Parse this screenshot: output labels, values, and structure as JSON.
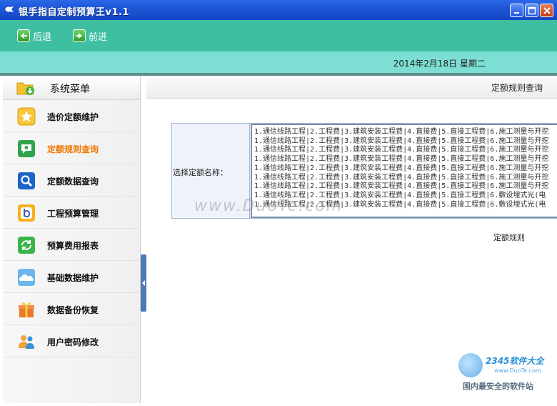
{
  "window": {
    "title": "银手指自定制预算王v1.1"
  },
  "toolbar": {
    "back_label": "后退",
    "forward_label": "前进"
  },
  "status": {
    "date": "2014年2月18日  星期二"
  },
  "sidebar": {
    "header": "系统菜单",
    "items": [
      {
        "label": "造价定额维护",
        "icon": "star-icon",
        "color": "#f2b01e"
      },
      {
        "label": "定额规则查询",
        "icon": "speech-bubble-icon",
        "color": "#2fa34a",
        "active": true
      },
      {
        "label": "定额数据查询",
        "icon": "magnifier-icon",
        "color": "#1d63c8"
      },
      {
        "label": "工程预算管理",
        "icon": "letter-b-icon",
        "color": "#f2a21e"
      },
      {
        "label": "预算费用报表",
        "icon": "refresh-icon",
        "color": "#3cb44a"
      },
      {
        "label": "基础数据维护",
        "icon": "cloud-icon",
        "color": "#3a8fd8"
      },
      {
        "label": "数据备份恢复",
        "icon": "gift-icon",
        "color": "#e8782a"
      },
      {
        "label": "用户密码修改",
        "icon": "users-icon",
        "color": "#e07a2a"
      }
    ]
  },
  "main": {
    "title": "定额规则查询",
    "field_label": "选择定额名称：",
    "rules_label": "定额规则",
    "list_rows": [
      "1.通信线路工程|2.工程费|3.建筑安装工程费|4.直接费|5.直接工程费|6.施工测量与开挖",
      "1.通信线路工程|2.工程费|3.建筑安装工程费|4.直接费|5.直接工程费|6.施工测量与开挖",
      "1.通信线路工程|2.工程费|3.建筑安装工程费|4.直接费|5.直接工程费|6.施工测量与开挖",
      "1.通信线路工程|2.工程费|3.建筑安装工程费|4.直接费|5.直接工程费|6.施工测量与开挖",
      "1.通信线路工程|2.工程费|3.建筑安装工程费|4.直接费|5.直接工程费|6.施工测量与开挖",
      "1.通信线路工程|2.工程费|3.建筑安装工程费|4.直接费|5.直接工程费|6.施工测量与开挖",
      "1.通信线路工程|2.工程费|3.建筑安装工程费|4.直接费|5.直接工程费|6.施工测量与开挖",
      "1.通信线路工程|2.工程费|3.建筑安装工程费|4.直接费|5.直接工程费|6.敷设埋式光(电",
      "1.通信线路工程|2.工程费|3.建筑安装工程费|4.直接费|5.直接工程费|6.敷设埋式光(电"
    ]
  },
  "watermark": {
    "brand": "2345软件大全",
    "url": "www.DuoTe.com",
    "slogan": "国内最安全的软件站",
    "center": "www.DuoTe.com"
  },
  "colors": {
    "toolbar": "#3fbfa2",
    "datebar": "#7ddfd3",
    "active_text": "#f07800",
    "titlebar": "#1d56d6"
  }
}
